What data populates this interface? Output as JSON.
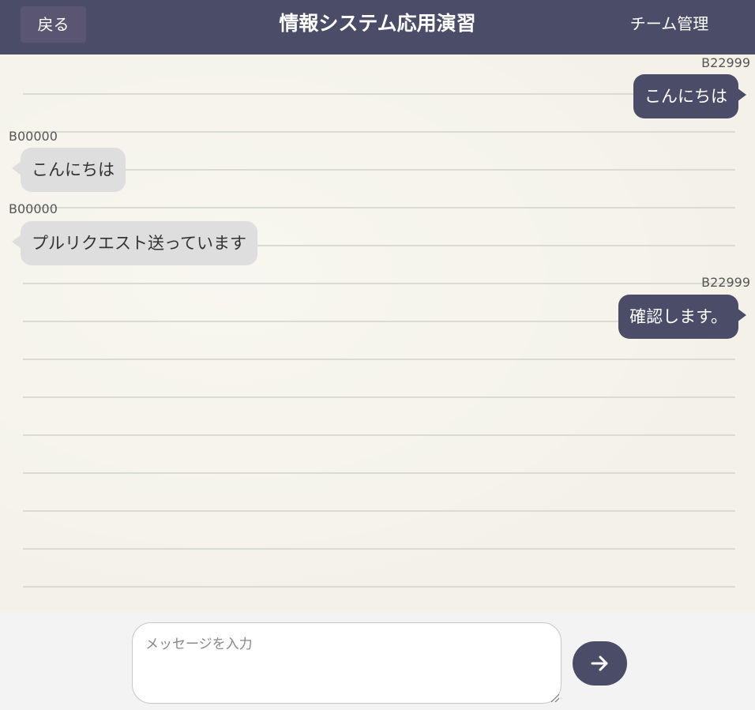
{
  "header": {
    "back_label": "戻る",
    "title": "情報システム応用演習",
    "team_label": "チーム管理"
  },
  "messages": [
    {
      "sender": "B22999",
      "text": "こんにちは",
      "mine": true
    },
    {
      "sender": "B00000",
      "text": "こんにちは",
      "mine": false
    },
    {
      "sender": "B00000",
      "text": "プルリクエスト送っています",
      "mine": false
    },
    {
      "sender": "B22999",
      "text": "確認します。",
      "mine": true
    }
  ],
  "composer": {
    "placeholder": "メッセージを入力",
    "value": "",
    "send_icon": "arrow-right-icon"
  },
  "colors": {
    "accent": "#4a4c68",
    "other_bubble": "#dedede",
    "chat_background": "#f4f2e8",
    "rule_line": "#d7dcd6"
  }
}
